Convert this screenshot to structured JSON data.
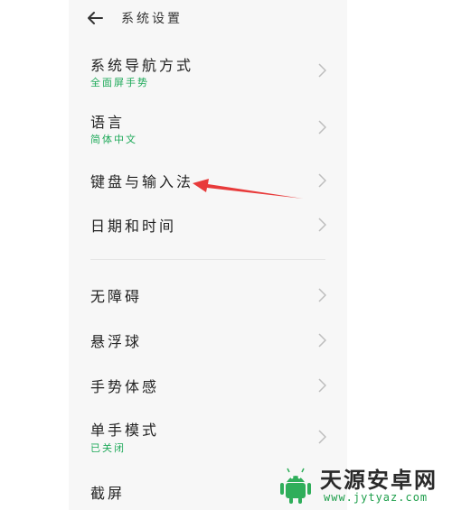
{
  "header": {
    "title": "系统设置",
    "back_icon": "arrow-left-icon"
  },
  "items": [
    {
      "id": "nav-mode",
      "title": "系统导航方式",
      "subtitle": "全面屏手势"
    },
    {
      "id": "language",
      "title": "语言",
      "subtitle": "简体中文"
    },
    {
      "id": "keyboard",
      "title": "键盘与输入法"
    },
    {
      "id": "datetime",
      "title": "日期和时间"
    },
    {
      "id": "accessibility",
      "title": "无障碍"
    },
    {
      "id": "floating-ball",
      "title": "悬浮球"
    },
    {
      "id": "gesture",
      "title": "手势体感"
    },
    {
      "id": "one-hand",
      "title": "单手模式",
      "subtitle": "已关闭"
    },
    {
      "id": "screenshot",
      "title": "截屏"
    }
  ],
  "annotation": {
    "color": "#e83b3b",
    "target": "键盘与输入法"
  },
  "watermark": {
    "name": "天源安卓网",
    "url": "www.jytyaz.com",
    "color": "#1f9f4c"
  },
  "colors": {
    "accent_green": "#1faa5a",
    "chevron": "#bdbdbd"
  }
}
